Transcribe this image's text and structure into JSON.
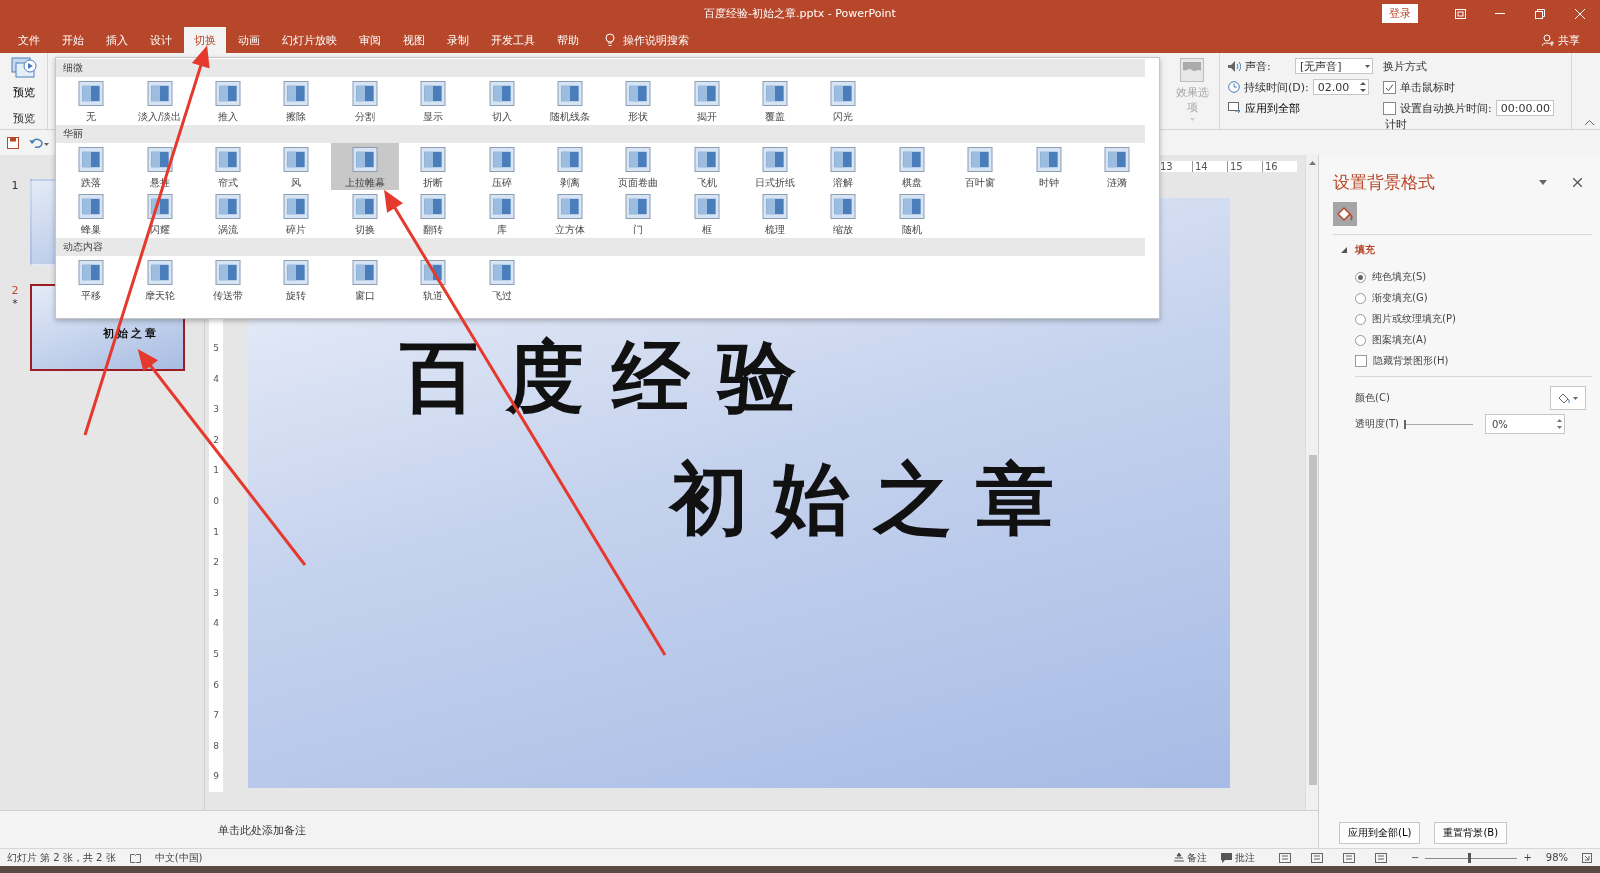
{
  "window": {
    "title": "百度经验-初始之章.pptx - PowerPoint",
    "login": "登录"
  },
  "tabs": [
    {
      "label": "文件",
      "selected": false
    },
    {
      "label": "开始",
      "selected": false
    },
    {
      "label": "插入",
      "selected": false
    },
    {
      "label": "设计",
      "selected": false
    },
    {
      "label": "切换",
      "selected": true
    },
    {
      "label": "动画",
      "selected": false
    },
    {
      "label": "幻灯片放映",
      "selected": false
    },
    {
      "label": "审阅",
      "selected": false
    },
    {
      "label": "视图",
      "selected": false
    },
    {
      "label": "录制",
      "selected": false
    },
    {
      "label": "开发工具",
      "selected": false
    },
    {
      "label": "帮助",
      "selected": false
    }
  ],
  "tell_me": "操作说明搜索",
  "share": "共享",
  "ribbon": {
    "preview": {
      "label": "预览",
      "group": "预览"
    },
    "effect_options": {
      "label": "效果选项",
      "disabled": true
    },
    "sound": {
      "label": "声音:",
      "value": "[无声音]"
    },
    "duration": {
      "label": "持续时间(D):",
      "value": "02.00"
    },
    "apply_all": "应用到全部",
    "advance": {
      "title": "换片方式",
      "on_click": {
        "label": "单击鼠标时",
        "checked": true
      },
      "after": {
        "label": "设置自动换片时间:",
        "checked": false,
        "value": "00:00.00"
      }
    },
    "group": "计时"
  },
  "gallery": {
    "sections": [
      {
        "title": "细微",
        "items": [
          {
            "label": "无",
            "selected": false
          },
          {
            "label": "淡入/淡出",
            "selected": false
          },
          {
            "label": "推入",
            "selected": false
          },
          {
            "label": "擦除",
            "selected": false
          },
          {
            "label": "分割",
            "selected": false
          },
          {
            "label": "显示",
            "selected": false
          },
          {
            "label": "切入",
            "selected": false
          },
          {
            "label": "随机线条",
            "selected": false
          },
          {
            "label": "形状",
            "selected": false
          },
          {
            "label": "揭开",
            "selected": false
          },
          {
            "label": "覆盖",
            "selected": false
          },
          {
            "label": "闪光",
            "selected": false
          }
        ]
      },
      {
        "title": "华丽",
        "items": [
          {
            "label": "跌落",
            "selected": false
          },
          {
            "label": "悬挂",
            "selected": false
          },
          {
            "label": "帘式",
            "selected": false
          },
          {
            "label": "风",
            "selected": false
          },
          {
            "label": "上拉帷幕",
            "selected": true
          },
          {
            "label": "折断",
            "selected": false
          },
          {
            "label": "压碎",
            "selected": false
          },
          {
            "label": "剥离",
            "selected": false
          },
          {
            "label": "页面卷曲",
            "selected": false
          },
          {
            "label": "飞机",
            "selected": false
          },
          {
            "label": "日式折纸",
            "selected": false
          },
          {
            "label": "溶解",
            "selected": false
          },
          {
            "label": "棋盘",
            "selected": false
          },
          {
            "label": "百叶窗",
            "selected": false
          },
          {
            "label": "时钟",
            "selected": false
          },
          {
            "label": "涟漪",
            "selected": false
          },
          {
            "label": "蜂巢",
            "selected": false
          },
          {
            "label": "闪耀",
            "selected": false
          },
          {
            "label": "涡流",
            "selected": false
          },
          {
            "label": "碎片",
            "selected": false
          },
          {
            "label": "切换",
            "selected": false
          },
          {
            "label": "翻转",
            "selected": false
          },
          {
            "label": "库",
            "selected": false
          },
          {
            "label": "立方体",
            "selected": false
          },
          {
            "label": "门",
            "selected": false
          },
          {
            "label": "框",
            "selected": false
          },
          {
            "label": "梳理",
            "selected": false
          },
          {
            "label": "缩放",
            "selected": false
          },
          {
            "label": "随机",
            "selected": false
          }
        ]
      },
      {
        "title": "动态内容",
        "items": [
          {
            "label": "平移",
            "selected": false
          },
          {
            "label": "摩天轮",
            "selected": false
          },
          {
            "label": "传送带",
            "selected": false
          },
          {
            "label": "旋转",
            "selected": false
          },
          {
            "label": "窗口",
            "selected": false
          },
          {
            "label": "轨道",
            "selected": false
          },
          {
            "label": "飞过",
            "selected": false
          }
        ]
      }
    ]
  },
  "thumbnails": [
    {
      "number": "1",
      "selected": false
    },
    {
      "number": "2",
      "marker": "*",
      "text": "初始之章",
      "selected": true
    }
  ],
  "ruler": {
    "horizontal": [
      "13",
      "14",
      "15",
      "16"
    ],
    "vertical": [
      "5",
      "4",
      "3",
      "2",
      "1",
      "0",
      "1",
      "2",
      "3",
      "4",
      "5",
      "6",
      "7",
      "8",
      "9"
    ]
  },
  "slide": {
    "title": "百度经验",
    "subtitle": "初始之章"
  },
  "notes_placeholder": "单击此处添加备注",
  "format_pane": {
    "title": "设置背景格式",
    "section": {
      "title": "填充",
      "expanded": true
    },
    "options": [
      {
        "label": "纯色填充(S)",
        "selected": true
      },
      {
        "label": "渐变填充(G)",
        "selected": false
      },
      {
        "label": "图片或纹理填充(P)",
        "selected": false
      },
      {
        "label": "图案填充(A)",
        "selected": false
      }
    ],
    "hide_graphics": {
      "label": "隐藏背景图形(H)",
      "checked": false
    },
    "color_label": "颜色(C)",
    "transparency": {
      "label": "透明度(T)",
      "level": 0,
      "value": "0%"
    },
    "buttons": [
      "应用到全部(L)",
      "重置背景(B)"
    ]
  },
  "status_bar": {
    "slide_info": "幻灯片 第 2 张，共 2 张",
    "language": "中文(中国)",
    "notes": "备注",
    "comments": "批注",
    "zoom_out": "−",
    "zoom_in": "+",
    "zoom": {
      "level": 0.48
    },
    "zoom_value": "98%"
  }
}
